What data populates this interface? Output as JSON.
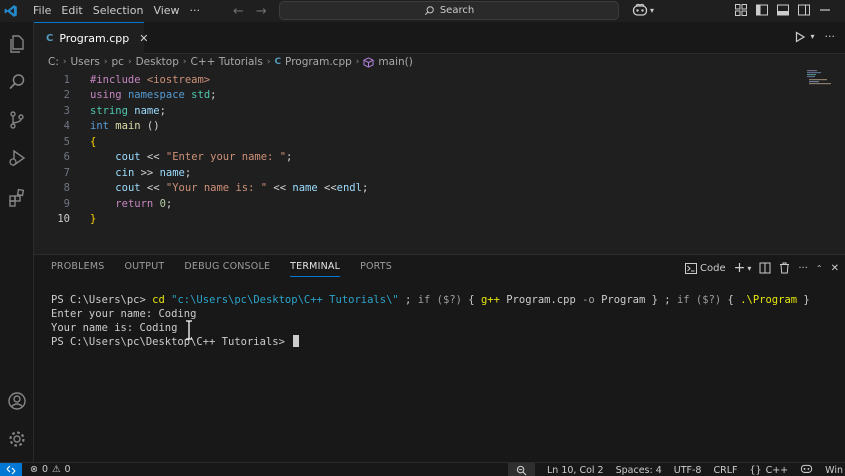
{
  "menu": [
    "File",
    "Edit",
    "Selection",
    "View",
    "···"
  ],
  "search": {
    "label": "Search"
  },
  "tab": {
    "label": "Program.cpp",
    "icon": "C",
    "close": "✕"
  },
  "breadcrumb": [
    "C:",
    "Users",
    "pc",
    "Desktop",
    "C++ Tutorials",
    "Program.cpp",
    "main()"
  ],
  "code_lines": [
    {
      "n": "1",
      "html": "<span class=\"inc\">#include</span> <span class=\"str\">&lt;iostream&gt;</span>"
    },
    {
      "n": "2",
      "html": "<span class=\"ctl\">using</span> <span class=\"kw\">namespace</span> <span class=\"ty\">std</span><span class=\"op\">;</span>"
    },
    {
      "n": "3",
      "html": "<span class=\"ty\">string</span> <span class=\"var\">name</span><span class=\"op\">;</span>"
    },
    {
      "n": "4",
      "html": "<span class=\"kw\">int</span> <span class=\"fn\">main</span> <span class=\"op\">()</span>"
    },
    {
      "n": "5",
      "html": "<span class=\"brace\">{</span>"
    },
    {
      "n": "6",
      "html": "    <span class=\"var\">cout</span> <span class=\"op\">&lt;&lt;</span> <span class=\"str\">\"Enter your name: \"</span><span class=\"op\">;</span>"
    },
    {
      "n": "7",
      "html": "    <span class=\"var\">cin</span> <span class=\"op\">&gt;&gt;</span> <span class=\"var\">name</span><span class=\"op\">;</span>"
    },
    {
      "n": "8",
      "html": "    <span class=\"var\">cout</span> <span class=\"op\">&lt;&lt;</span> <span class=\"str\">\"Your name is: \"</span> <span class=\"op\">&lt;&lt;</span> <span class=\"var\">name</span> <span class=\"op\">&lt;&lt;</span><span class=\"var\">endl</span><span class=\"op\">;</span>"
    },
    {
      "n": "9",
      "html": "    <span class=\"ctl\">return</span> <span class=\"num\">0</span><span class=\"op\">;</span>"
    },
    {
      "n": "10",
      "html": "<span class=\"brace\">}</span>"
    }
  ],
  "code_text": [
    "#include <iostream>",
    "using namespace std;",
    "string name;",
    "int main ()",
    "{",
    "    cout << \"Enter your name: \";",
    "    cin >> name;",
    "    cout << \"Your name is: \" << name <<endl;",
    "    return 0;",
    "}"
  ],
  "panel": {
    "tabs": [
      "PROBLEMS",
      "OUTPUT",
      "DEBUG CONSOLE",
      "TERMINAL",
      "PORTS"
    ],
    "active_tab": "TERMINAL",
    "shell_label": "Code"
  },
  "terminal": {
    "line1_prompt": "PS C:\\Users\\pc> ",
    "line1_cmd": "cd \"c:\\Users\\pc\\Desktop\\C++ Tutorials\\\" ; if ($?) { g++ Program.cpp -o Program } ; if ($?) { .\\Program }",
    "line2": "Enter your name: Coding",
    "line3": "Your name is: Coding",
    "line4": "PS C:\\Users\\pc\\Desktop\\C++ Tutorials> "
  },
  "status": {
    "errors": "0",
    "warnings": "0",
    "position": "Ln 10, Col 2",
    "spaces": "Spaces: 4",
    "encoding": "UTF-8",
    "eol": "CRLF",
    "language": "C++",
    "platform": "Win"
  },
  "colors": {
    "accent": "#0078d4",
    "bg": "#1f1f1f"
  }
}
